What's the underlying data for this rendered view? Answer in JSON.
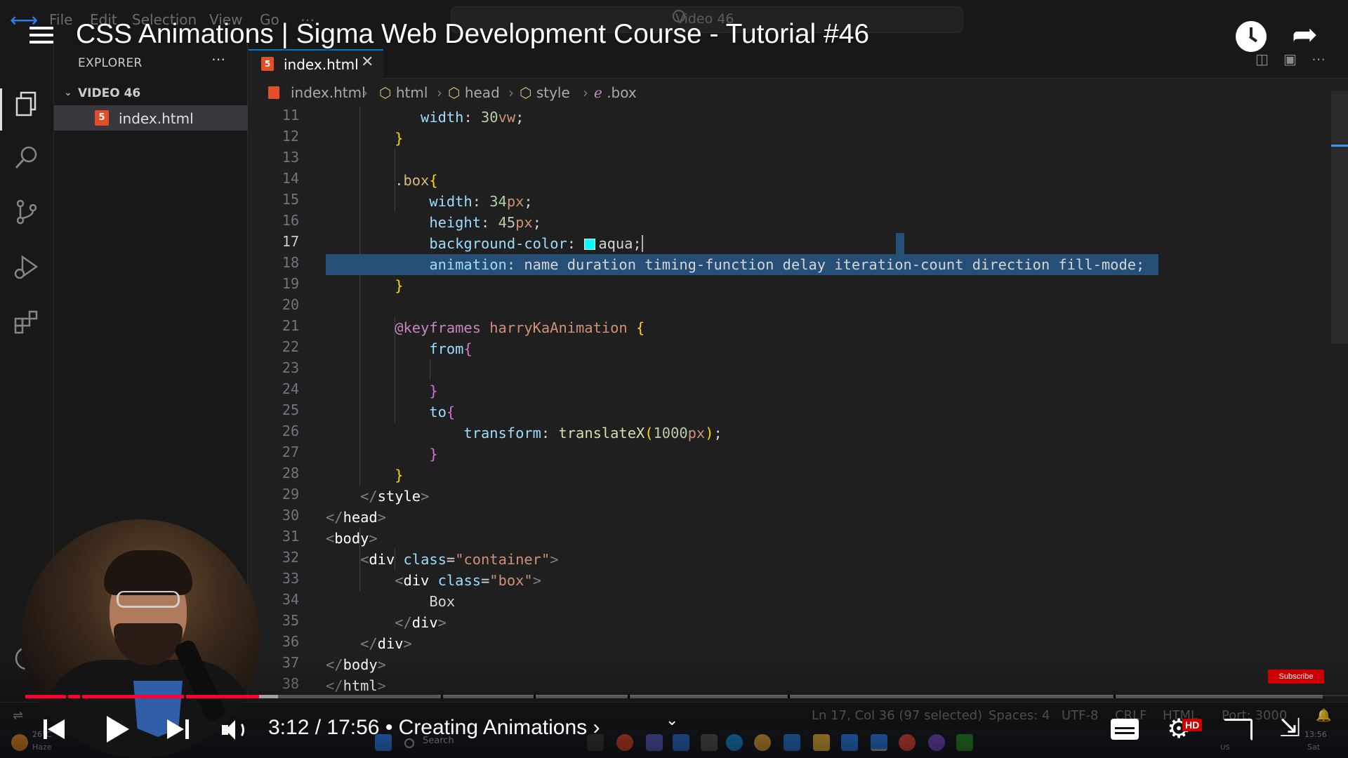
{
  "vscode": {
    "menu": [
      "File",
      "Edit",
      "Selection",
      "View",
      "Go",
      "⋯"
    ],
    "command_center": "Video 46",
    "explorer": {
      "title": "EXPLORER",
      "more": "⋯",
      "folder": "VIDEO 46",
      "files": [
        "index.html"
      ]
    },
    "tab": {
      "label": "index.html",
      "close": "✕",
      "icon": "5"
    },
    "breadcrumbs": [
      "index.html",
      "html",
      "head",
      "style",
      ".box"
    ],
    "active_line": 17,
    "line_numbers": [
      11,
      12,
      13,
      14,
      15,
      16,
      17,
      18,
      19,
      20,
      21,
      22,
      23,
      24,
      25,
      26,
      27,
      28,
      29,
      30,
      31,
      32,
      33,
      34,
      35,
      36,
      37,
      38
    ],
    "status": {
      "position": "Ln 17, Col 36 (97 selected)",
      "spaces": "Spaces: 4",
      "encoding": "UTF-8",
      "eol": "CRLF",
      "language": "HTML",
      "port": "Port: 3000"
    }
  },
  "youtube": {
    "title": "CSS Animations | Sigma Web Development Course - Tutorial #46",
    "time": "3:12 / 17:56",
    "chapter": "• Creating Animations ›",
    "progress_fraction": 0.18,
    "hd_badge": "HD",
    "subscribe": "Subscribe"
  },
  "taskbar": {
    "weather_temp": "26°C",
    "weather_desc": "Haze",
    "search": "Search",
    "lang": "US",
    "clock": "13:56",
    "day": "Sat"
  },
  "colors": {
    "accent": "#0078d4",
    "selection": "#264f78",
    "youtube_red": "#ff0033",
    "swatch_aqua": "#00ffff"
  }
}
